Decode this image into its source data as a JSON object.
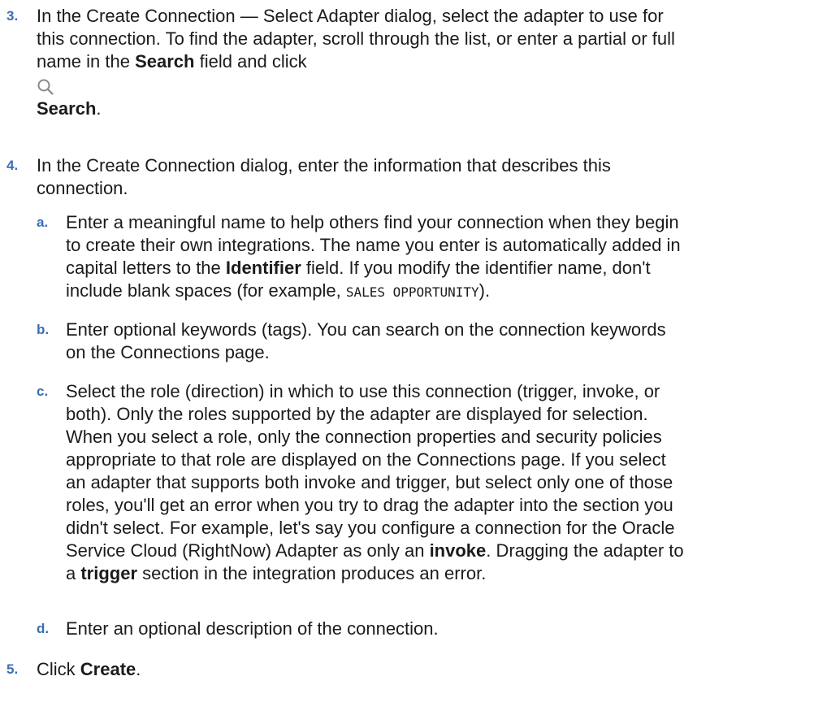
{
  "steps": [
    {
      "number": "3.",
      "line1": "In the Create Connection — Select Adapter dialog, select the adapter to use for",
      "line2": "this connection. To find the adapter, scroll through the list, or enter a partial or full",
      "line3_a": "name in the ",
      "line3_b": "Search",
      "line3_c": " field and click",
      "icon": "search-icon",
      "line5_a": "Search",
      "line5_b": "."
    },
    {
      "number": "4.",
      "line1": "In the Create Connection dialog, enter the information that describes this",
      "line2": "connection."
    },
    {
      "number": "5.",
      "text_a": "Click ",
      "text_b": "Create",
      "text_c": "."
    }
  ],
  "substeps": [
    {
      "letter": "a.",
      "l1": "Enter a meaningful name to help others find your connection when they begin",
      "l2": "to create their own integrations. The name you enter is automatically added in",
      "l3_a": "capital letters to the ",
      "l3_b": "Identifier",
      "l3_c": " field. If you modify the identifier name, don't",
      "l4_a": "include blank spaces (for example, ",
      "l4_code": "SALES OPPORTUNITY",
      "l4_c": ")."
    },
    {
      "letter": "b.",
      "l1": "Enter optional keywords (tags). You can search on the connection keywords",
      "l2": "on the Connections page."
    },
    {
      "letter": "c.",
      "l1": "Select the role (direction) in which to use this connection (trigger, invoke, or",
      "l2": "both). Only the roles supported by the adapter are displayed for selection.",
      "l3": "When you select a role, only the connection properties and security policies",
      "l4": "appropriate to that role are displayed on the Connections page. If you select",
      "l5": "an adapter that supports both invoke and trigger, but select only one of those",
      "l6": "roles, you'll get an error when you try to drag the adapter into the section you",
      "l7": "didn't select. For example, let's say you configure a connection for the Oracle",
      "l8_a": "Service Cloud (RightNow) Adapter as only an ",
      "l8_b": "invoke",
      "l8_c": ". Dragging the adapter to",
      "l9_a": "a ",
      "l9_b": "trigger",
      "l9_c": " section in the integration produces an error."
    },
    {
      "letter": "d.",
      "l1": "Enter an optional description of the connection."
    }
  ],
  "colors": {
    "number": "#3a6eb4",
    "text": "#1b1b1b",
    "icon": "#8a8a8a"
  }
}
